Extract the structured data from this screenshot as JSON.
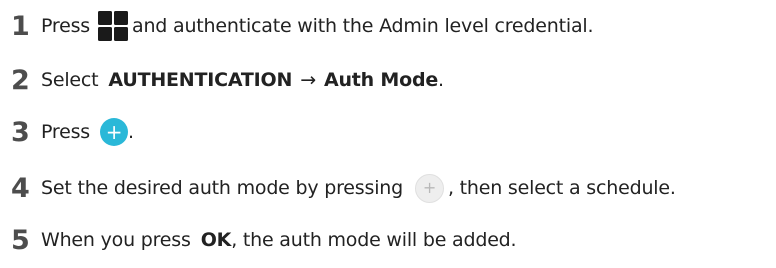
{
  "steps": [
    {
      "number": "1",
      "text_before": "Press",
      "icon": "grid-menu-icon",
      "text_after": "and authenticate with the Admin level credential."
    },
    {
      "number": "2",
      "text_before": "Select",
      "bold_1": "AUTHENTICATION",
      "arrow": "→",
      "bold_2": "Auth Mode",
      "text_after": "."
    },
    {
      "number": "3",
      "text_before": "Press",
      "icon": "plus-circle-icon",
      "icon_glyph": "+",
      "text_after": "."
    },
    {
      "number": "4",
      "text_before": "Set the desired auth mode by pressing",
      "icon": "plus-circle-grey-icon",
      "icon_glyph": "+",
      "text_after": ", then select a schedule."
    },
    {
      "number": "5",
      "text_before": "When you press",
      "bold_1": "OK",
      "text_after": ", the auth mode will be added."
    }
  ],
  "colors": {
    "accent_plus": "#2ab8d8",
    "grey_plus": "#eeeeee",
    "step_number": "#4d4d4d",
    "text": "#222222"
  }
}
